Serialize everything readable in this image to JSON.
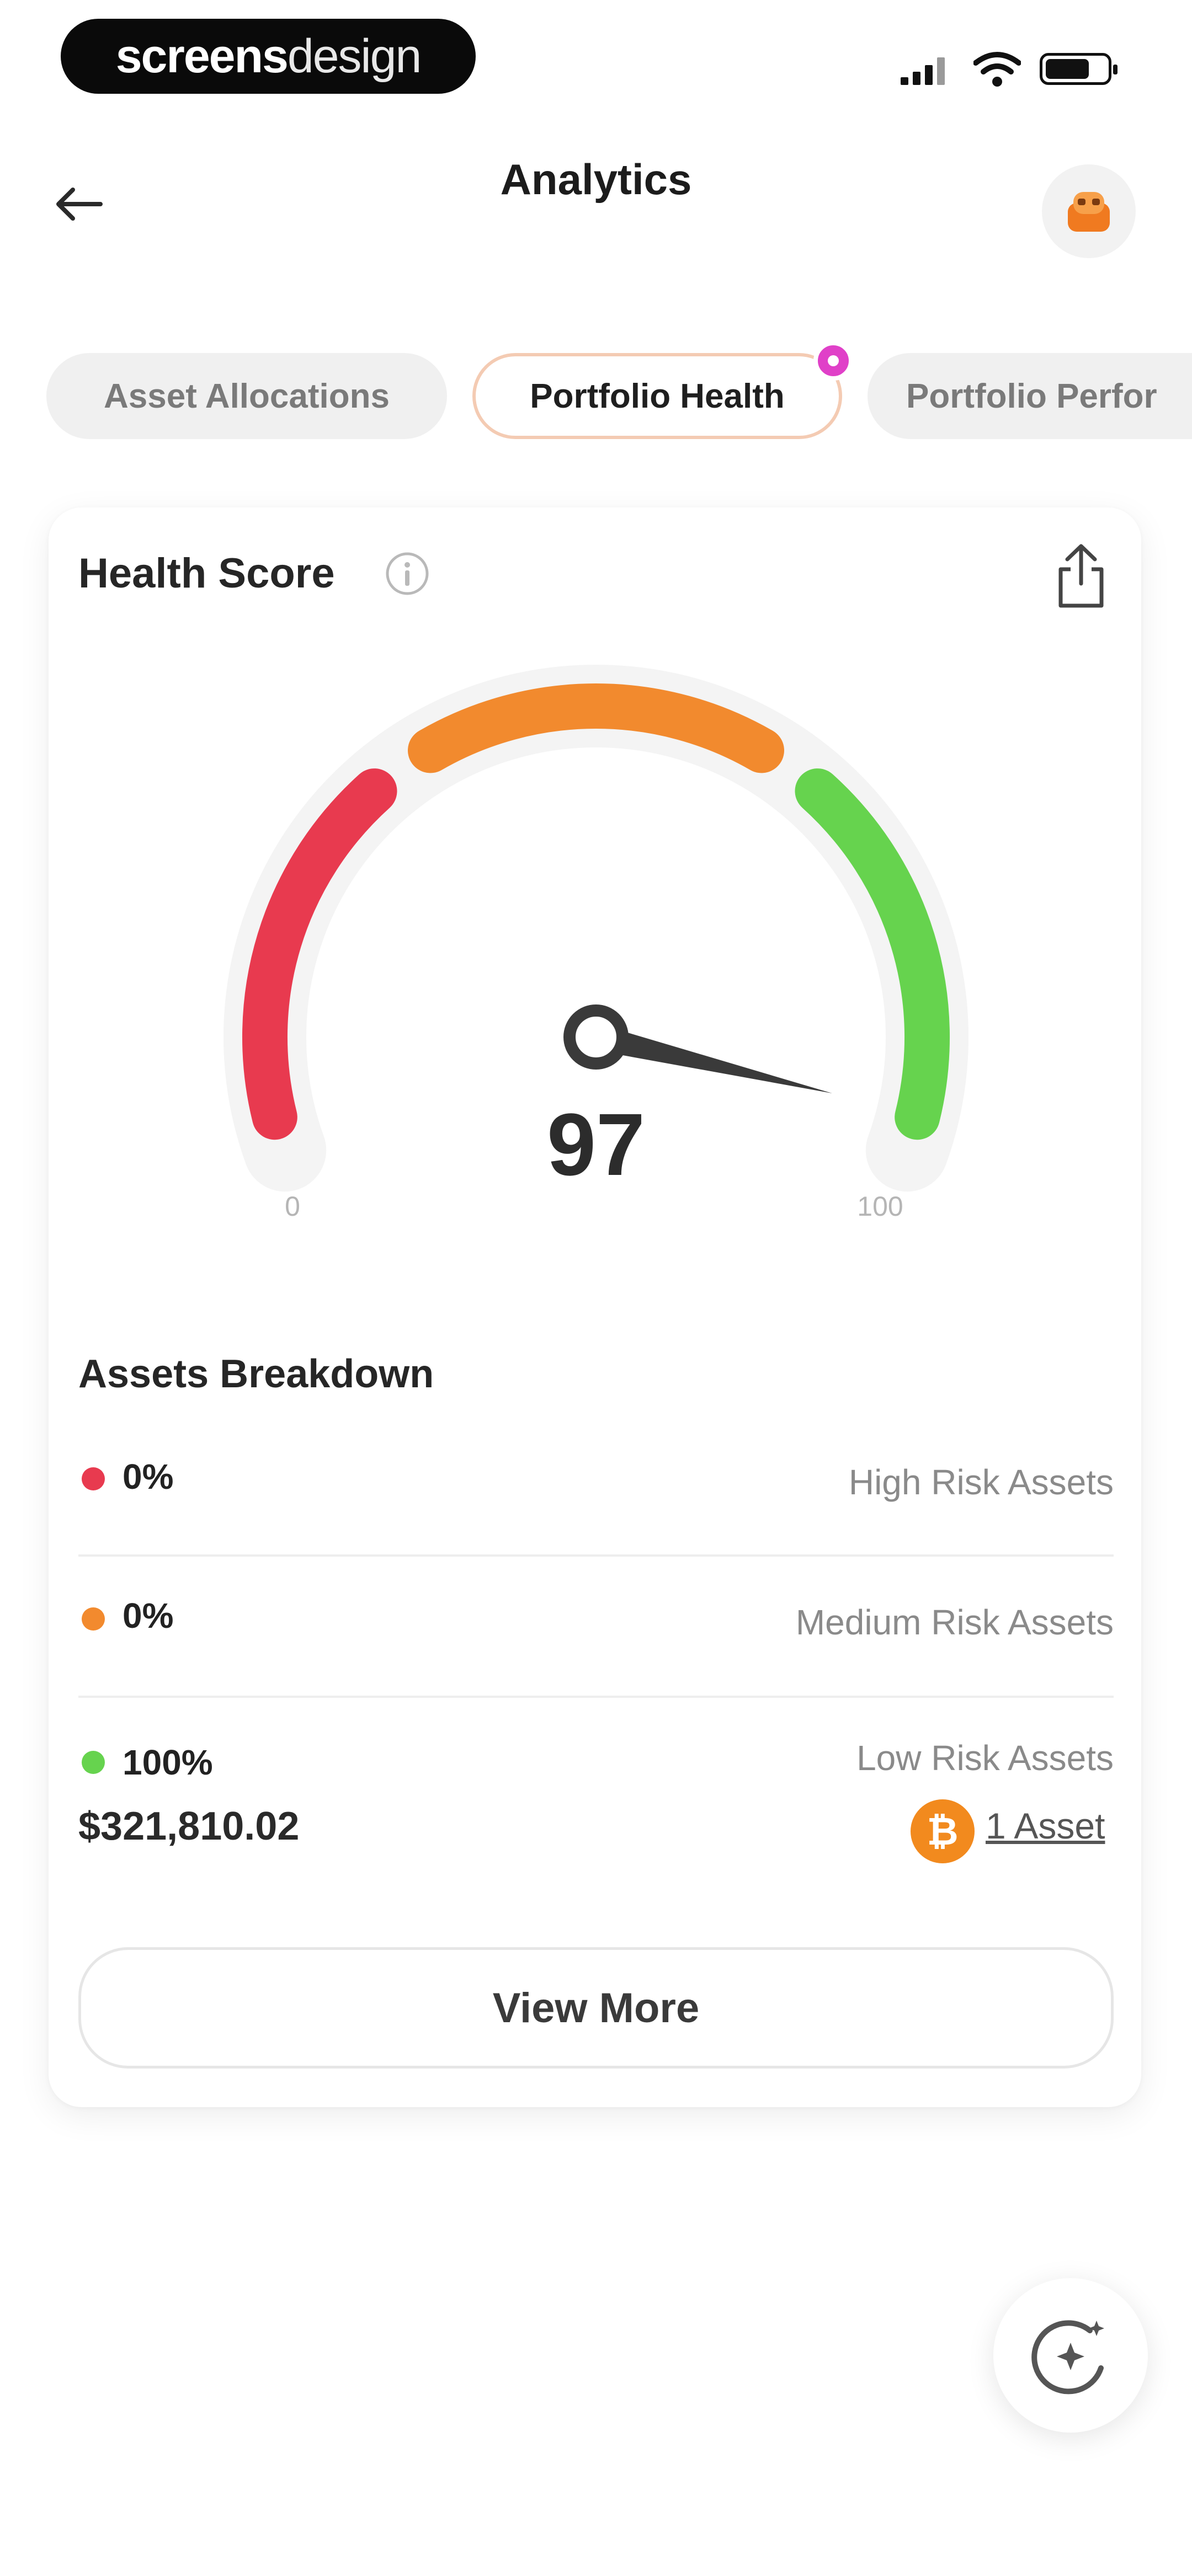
{
  "status_bar": {
    "watermark_bold": "screens",
    "watermark_light": "design",
    "icons": [
      "signal-icon",
      "wifi-icon",
      "battery-icon"
    ]
  },
  "header": {
    "title": "Analytics",
    "back_icon": "arrow-left-icon",
    "avatar_icon": "user-avatar-icon"
  },
  "tabs": [
    {
      "label": "Asset Allocations",
      "active": false
    },
    {
      "label": "Portfolio Health",
      "active": true
    },
    {
      "label": "Portfolio Perfor",
      "active": false
    }
  ],
  "health_card": {
    "title": "Health Score",
    "info_icon": "info-icon",
    "share_icon": "share-icon",
    "score": "97",
    "score_fraction": 0.97,
    "min_label": "0",
    "max_label": "100",
    "gauge_colors": {
      "low": "#e83a4f",
      "mid": "#f28a2e",
      "high": "#66d34e"
    }
  },
  "breakdown": {
    "title": "Assets Breakdown",
    "rows": [
      {
        "percent": "0%",
        "label": "High Risk Assets",
        "color": "#e83a4f"
      },
      {
        "percent": "0%",
        "label": "Medium Risk Assets",
        "color": "#f28a2e"
      },
      {
        "percent": "100%",
        "label": "Low Risk Assets",
        "color": "#66d34e",
        "amount": "$321,810.02",
        "asset_link": "1 Asset",
        "asset_icon": "bitcoin-icon"
      }
    ]
  },
  "view_more_label": "View More",
  "fab_icon": "ai-sparkle-icon",
  "colors": {
    "accent": "#f28a1e",
    "tab_active_border": "#f4cbb3",
    "badge": "#e040c8"
  }
}
